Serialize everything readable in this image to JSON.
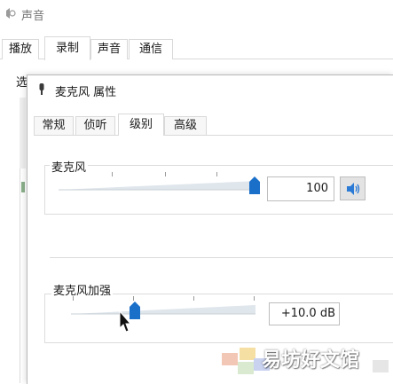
{
  "outer_window": {
    "title": "声音",
    "tabs": [
      "播放",
      "录制",
      "声音",
      "通信"
    ],
    "active_tab": "录制",
    "partial_text": "选"
  },
  "dialog": {
    "title": "麦克风 属性",
    "tabs": [
      "常规",
      "侦听",
      "级别",
      "高级"
    ],
    "active_tab": "级别",
    "microphone": {
      "label": "麦克风",
      "value": "100",
      "level": 1.0
    },
    "boost": {
      "label": "麦克风加强",
      "value": "+10.0 dB",
      "level": 0.33
    }
  },
  "watermark": {
    "text": "易坊好文馆"
  },
  "colors": {
    "thumb": "#1a6fc9",
    "mute_icon": "#2b7bd6",
    "track": "#dfe6ec"
  }
}
